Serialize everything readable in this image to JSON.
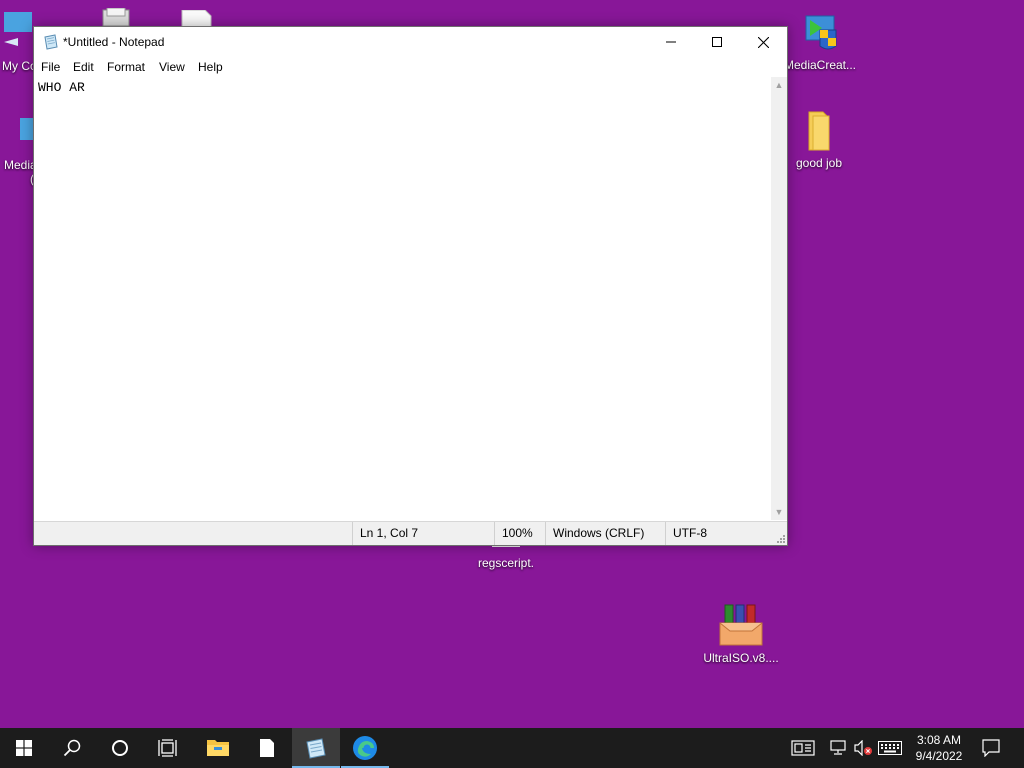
{
  "desktop": {
    "icons": [
      {
        "label": "My Co"
      },
      {
        "label": "Media"
      },
      {
        "label": "MediaCreat..."
      },
      {
        "label": "good job"
      },
      {
        "label": "regsceript."
      },
      {
        "label": "UltraISO.v8...."
      }
    ]
  },
  "notepad": {
    "title": "*Untitled - Notepad",
    "menu": [
      "File",
      "Edit",
      "Format",
      "View",
      "Help"
    ],
    "content": "WHO AR",
    "status": {
      "position": "Ln 1, Col 7",
      "zoom": "100%",
      "line_ending": "Windows (CRLF)",
      "encoding": "UTF-8"
    }
  },
  "taskbar": {
    "time": "3:08 AM",
    "date": "9/4/2022",
    "color": "#1c1c1c",
    "accent": "#76b9ed"
  },
  "colors": {
    "desktop_background": "#881798"
  }
}
